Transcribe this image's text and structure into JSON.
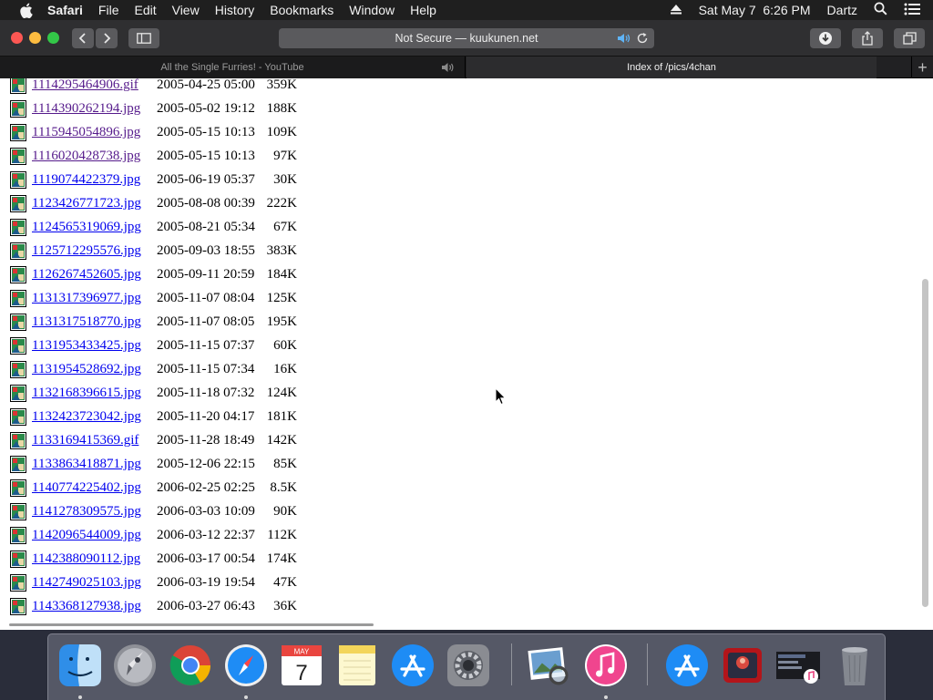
{
  "menubar": {
    "app": "Safari",
    "items": [
      "File",
      "Edit",
      "View",
      "History",
      "Bookmarks",
      "Window",
      "Help"
    ],
    "clock": "Sat May 7  6:26 PM",
    "user": "Dartz"
  },
  "toolbar": {
    "address": "Not Secure — kuukunen.net"
  },
  "tabs": [
    {
      "title": "All the Single Furries! - YouTube",
      "active": false
    },
    {
      "title": "Index of /pics/4chan",
      "active": true
    }
  ],
  "files": [
    {
      "name": "1114295464906.gif",
      "date": "2005-04-25 05:00",
      "size": "359K",
      "visited": true
    },
    {
      "name": "1114390262194.jpg",
      "date": "2005-05-02 19:12",
      "size": "188K",
      "visited": true
    },
    {
      "name": "1115945054896.jpg",
      "date": "2005-05-15 10:13",
      "size": "109K",
      "visited": true
    },
    {
      "name": "1116020428738.jpg",
      "date": "2005-05-15 10:13",
      "size": "97K",
      "visited": true
    },
    {
      "name": "1119074422379.jpg",
      "date": "2005-06-19 05:37",
      "size": "30K",
      "visited": false
    },
    {
      "name": "1123426771723.jpg",
      "date": "2005-08-08 00:39",
      "size": "222K",
      "visited": false
    },
    {
      "name": "1124565319069.jpg",
      "date": "2005-08-21 05:34",
      "size": "67K",
      "visited": false
    },
    {
      "name": "1125712295576.jpg",
      "date": "2005-09-03 18:55",
      "size": "383K",
      "visited": false
    },
    {
      "name": "1126267452605.jpg",
      "date": "2005-09-11 20:59",
      "size": "184K",
      "visited": false
    },
    {
      "name": "1131317396977.jpg",
      "date": "2005-11-07 08:04",
      "size": "125K",
      "visited": false
    },
    {
      "name": "1131317518770.jpg",
      "date": "2005-11-07 08:05",
      "size": "195K",
      "visited": false
    },
    {
      "name": "1131953433425.jpg",
      "date": "2005-11-15 07:37",
      "size": "60K",
      "visited": false
    },
    {
      "name": "1131954528692.jpg",
      "date": "2005-11-15 07:34",
      "size": "16K",
      "visited": false
    },
    {
      "name": "1132168396615.jpg",
      "date": "2005-11-18 07:32",
      "size": "124K",
      "visited": false
    },
    {
      "name": "1132423723042.jpg",
      "date": "2005-11-20 04:17",
      "size": "181K",
      "visited": false
    },
    {
      "name": "1133169415369.gif",
      "date": "2005-11-28 18:49",
      "size": "142K",
      "visited": false
    },
    {
      "name": "1133863418871.jpg",
      "date": "2005-12-06 22:15",
      "size": "85K",
      "visited": false
    },
    {
      "name": "1140774225402.jpg",
      "date": "2006-02-25 02:25",
      "size": "8.5K",
      "visited": false
    },
    {
      "name": "1141278309575.jpg",
      "date": "2006-03-03 10:09",
      "size": "90K",
      "visited": false
    },
    {
      "name": "1142096544009.jpg",
      "date": "2006-03-12 22:37",
      "size": "112K",
      "visited": false
    },
    {
      "name": "1142388090112.jpg",
      "date": "2006-03-17 00:54",
      "size": "174K",
      "visited": false
    },
    {
      "name": "1142749025103.jpg",
      "date": "2006-03-19 19:54",
      "size": "47K",
      "visited": false
    },
    {
      "name": "1143368127938.jpg",
      "date": "2006-03-27 06:43",
      "size": "36K",
      "visited": false
    }
  ],
  "dock": {
    "calendar_month": "MAY",
    "calendar_day": "7"
  },
  "colors": {
    "link": "#0000ee",
    "visited_link": "#551a8b",
    "accent_blue": "#1e8cf5"
  }
}
